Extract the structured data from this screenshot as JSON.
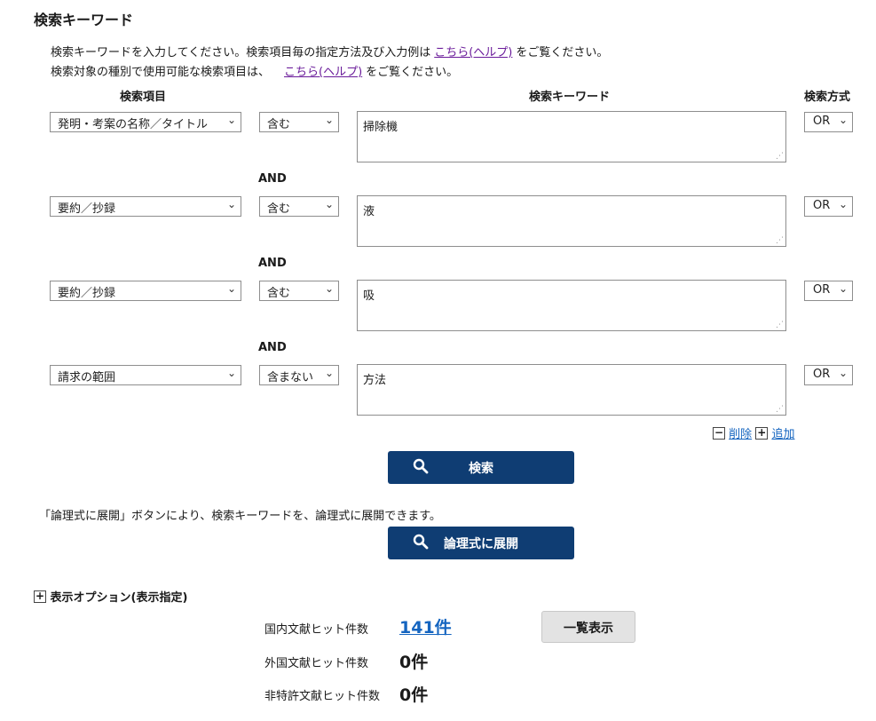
{
  "section_title": "検索キーワード",
  "info": {
    "line1_prefix": "検索キーワードを入力してください。検索項目毎の指定方法及び入力例は",
    "line1_link": "こちら(ヘルプ)",
    "line1_suffix": "をご覧ください。",
    "line2_prefix": "検索対象の種別で使用可能な検索項目は、",
    "line2_link": "こちら(ヘルプ)",
    "line2_suffix": "をご覧ください。"
  },
  "headers": {
    "item": "検索項目",
    "keyword": "検索キーワード",
    "method": "検索方式"
  },
  "rows": [
    {
      "field": "発明・考案の名称／タイトル",
      "condition": "含む",
      "keyword": "掃除機",
      "method": "OR"
    },
    {
      "field": "要約／抄録",
      "condition": "含む",
      "keyword": "液",
      "method": "OR"
    },
    {
      "field": "要約／抄録",
      "condition": "含む",
      "keyword": "吸",
      "method": "OR"
    },
    {
      "field": "請求の範囲",
      "condition": "含まない",
      "keyword": "方法",
      "method": "OR"
    }
  ],
  "connectors": [
    "AND",
    "AND",
    "AND"
  ],
  "row_actions": {
    "delete_label": "削除",
    "add_label": "追加"
  },
  "search_button": "検索",
  "expand_note": "「論理式に展開」ボタンにより、検索キーワードを、論理式に展開できます。",
  "expand_button": "論理式に展開",
  "display_options": "表示オプション(表示指定)",
  "hits": {
    "domestic_label": "国内文献ヒット件数",
    "domestic_value": "141件",
    "foreign_label": "外国文献ヒット件数",
    "foreign_value": "0件",
    "nonpatent_label": "非特許文献ヒット件数",
    "nonpatent_value": "0件"
  },
  "list_button": "一覧表示",
  "colors": {
    "primary": "#0f3d73",
    "link": "#1565c0",
    "visited_link": "#6a1b9a"
  }
}
